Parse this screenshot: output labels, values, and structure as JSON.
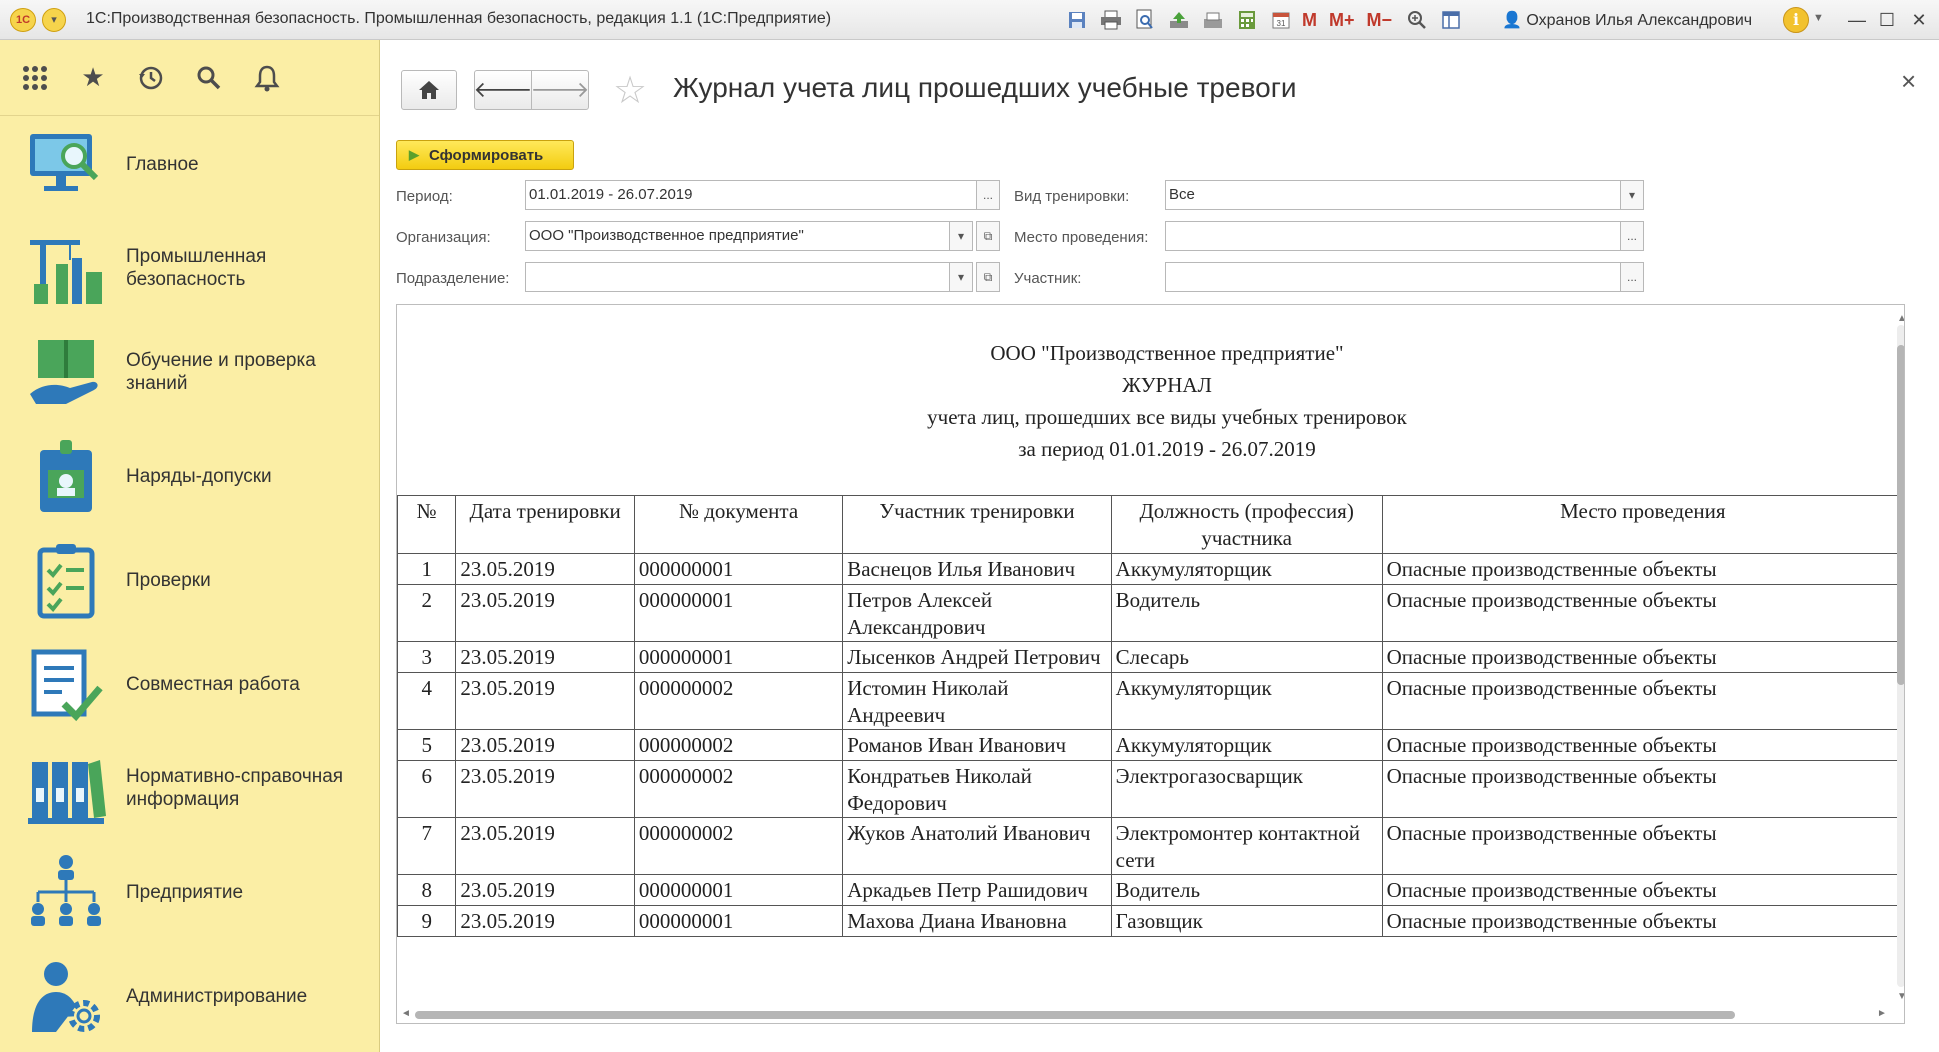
{
  "titlebar": {
    "app_title": "1С:Производственная безопасность. Промышленная безопасность, редакция 1.1  (1С:Предприятие)",
    "logo_text": "1С",
    "toolbar_text_buttons": [
      "M",
      "M+",
      "M−"
    ],
    "user_name": "Охранов Илья Александрович",
    "info_label": "i"
  },
  "sidebar": {
    "items": [
      {
        "label": "Главное",
        "icon": "monitor-search-icon"
      },
      {
        "label": "Промышленная безопасность",
        "icon": "industrial-crane-icon"
      },
      {
        "label": "Обучение и проверка знаний",
        "icon": "book-hand-icon"
      },
      {
        "label": "Наряды-допуски",
        "icon": "badge-lock-icon"
      },
      {
        "label": "Проверки",
        "icon": "checklist-clipboard-icon"
      },
      {
        "label": "Совместная работа",
        "icon": "document-check-icon"
      },
      {
        "label": "Нормативно-справочная информация",
        "icon": "binders-icon"
      },
      {
        "label": "Предприятие",
        "icon": "org-structure-icon"
      },
      {
        "label": "Администрирование",
        "icon": "user-gear-icon"
      }
    ]
  },
  "page": {
    "title": "Журнал учета лиц прошедших учебные тревоги",
    "generate_button": "Сформировать"
  },
  "form": {
    "period_label": "Период:",
    "period_value": "01.01.2019 - 26.07.2019",
    "org_label": "Организация:",
    "org_value": "ООО \"Производственное предприятие\"",
    "dept_label": "Подразделение:",
    "dept_value": "",
    "training_type_label": "Вид тренировки:",
    "training_type_value": "Все",
    "place_label": "Место проведения:",
    "place_value": "",
    "participant_label": "Участник:",
    "participant_value": "",
    "ellipsis": "...",
    "dropdown_arrow": "▾"
  },
  "report": {
    "header": [
      "ООО \"Производственное предприятие\"",
      "ЖУРНАЛ",
      "учета лиц, прошедших все виды учебных тренировок",
      "за период 01.01.2019 - 26.07.2019"
    ],
    "columns": [
      "№",
      "Дата тренировки",
      "№ документа",
      "Участник тренировки",
      "Должность (профессия) участника",
      "Место проведения"
    ],
    "rows": [
      [
        "1",
        "23.05.2019",
        "000000001",
        "Васнецов Илья Иванович",
        "Аккумуляторщик",
        "Опасные производственные объекты"
      ],
      [
        "2",
        "23.05.2019",
        "000000001",
        "Петров Алексей Александрович",
        "Водитель",
        "Опасные производственные объекты"
      ],
      [
        "3",
        "23.05.2019",
        "000000001",
        "Лысенков Андрей Петрович",
        "Слесарь",
        "Опасные производственные объекты"
      ],
      [
        "4",
        "23.05.2019",
        "000000002",
        "Истомин Николай Андреевич",
        "Аккумуляторщик",
        "Опасные производственные объекты"
      ],
      [
        "5",
        "23.05.2019",
        "000000002",
        "Романов Иван Иванович",
        "Аккумуляторщик",
        "Опасные производственные объекты"
      ],
      [
        "6",
        "23.05.2019",
        "000000002",
        "Кондратьев Николай Федорович",
        "Электрогазосварщик",
        "Опасные производственные объекты"
      ],
      [
        "7",
        "23.05.2019",
        "000000002",
        "Жуков Анатолий Иванович",
        "Электромонтер контактной сети",
        "Опасные производственные объекты"
      ],
      [
        "8",
        "23.05.2019",
        "000000001",
        "Аркадьев Петр Рашидович",
        "Водитель",
        "Опасные производственные объекты"
      ],
      [
        "9",
        "23.05.2019",
        "000000001",
        "Махова Диана Ивановна",
        "Газовщик",
        "Опасные производственные объекты"
      ]
    ]
  }
}
